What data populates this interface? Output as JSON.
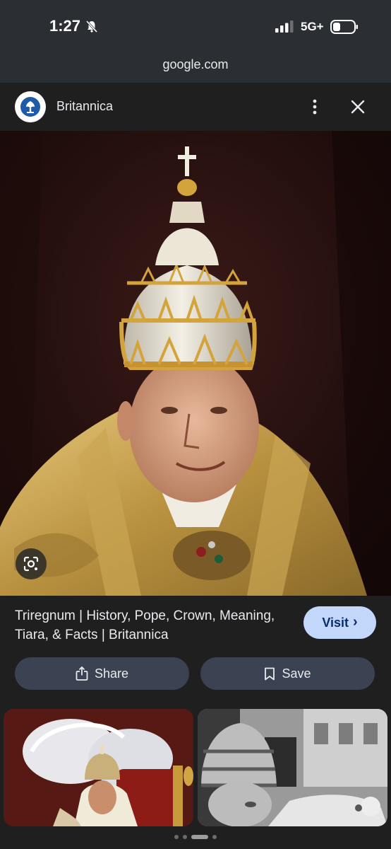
{
  "status_bar": {
    "time": "1:27",
    "network": "5G+"
  },
  "browser": {
    "url": "google.com"
  },
  "source": {
    "name": "Britannica"
  },
  "result": {
    "title": "Triregnum | History, Pope, Crown, Meaning, Tiara, & Facts | Britannica",
    "visit_label": "Visit",
    "share_label": "Share",
    "save_label": "Save"
  },
  "related_images": [
    {
      "icon": "pope-throne-photo"
    },
    {
      "icon": "pope-tiara-bw-photo"
    }
  ],
  "pagination": {
    "pages": 4,
    "active": 2
  },
  "colors": {
    "background": "#1f1f1f",
    "visit_button": "#c2d7fa",
    "action_button": "#3b4352"
  }
}
